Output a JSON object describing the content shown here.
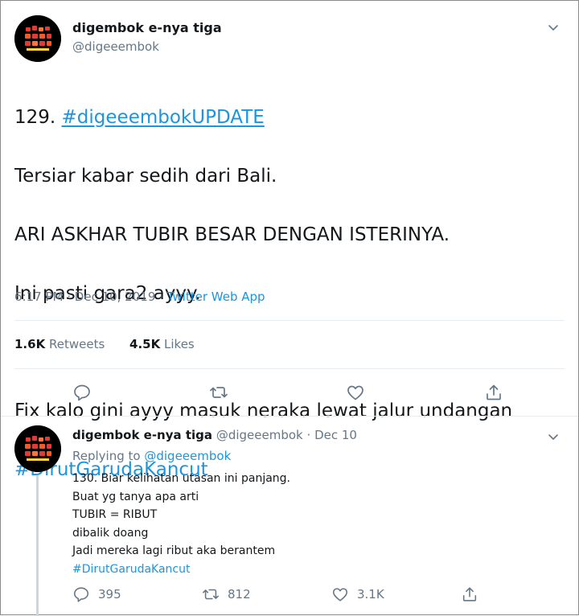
{
  "main_tweet": {
    "display_name": "digembok e-nya tiga",
    "handle": "@digeeembok",
    "number": "129.",
    "hashtag_update": "#digeeembokUPDATE",
    "lines": [
      "Tersiar kabar sedih dari Bali.",
      "ARI ASKHAR TUBIR BESAR DENGAN ISTERINYA.",
      "Ini pasti gara2 ayyy.",
      "",
      "Fix kalo gini ayyy masuk neraka lewat jalur undangan"
    ],
    "hashtag_end": "#DirutGarudaKancut",
    "time": "6:17 PM",
    "date": "Dec 10, 2019",
    "separator": "·",
    "source": "Twitter Web App",
    "retweets_count": "1.6K",
    "retweets_label": "Retweets",
    "likes_count": "4.5K",
    "likes_label": "Likes"
  },
  "reply_tweet": {
    "display_name": "digembok e-nya tiga",
    "handle": "@digeeembok",
    "separator": "·",
    "date": "Dec 10",
    "replying_label": "Replying to",
    "replying_to": "@digeeembok",
    "lines": [
      "130. Biar kelihatan utasan ini panjang.",
      "Buat yg tanya apa arti",
      "TUBIR = RIBUT",
      "dibalik doang",
      "Jadi mereka lagi ribut aka berantem"
    ],
    "hashtag": "#DirutGarudaKancut",
    "reply_count": "395",
    "retweet_count": "812",
    "like_count": "3.1K"
  },
  "icons": {
    "reply": "reply-icon",
    "retweet": "retweet-icon",
    "like": "heart-icon",
    "share": "share-icon",
    "menu": "chevron-down-icon"
  },
  "colors": {
    "link": "#1b95e0",
    "secondary": "#657786",
    "primary": "#14171a"
  }
}
